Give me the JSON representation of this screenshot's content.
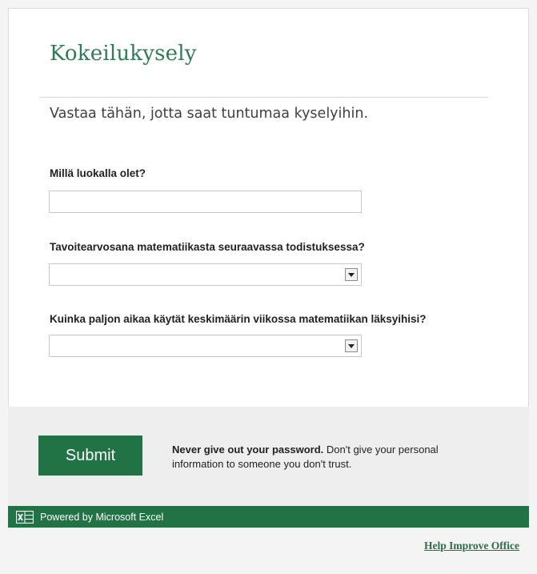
{
  "form": {
    "title": "Kokeilukysely",
    "description": "Vastaa tähän, jotta saat tuntumaa kyselyihin.",
    "questions": [
      {
        "label": "Millä luokalla olet?",
        "type": "text",
        "value": ""
      },
      {
        "label": "Tavoitearvosana matematiikasta seuraavassa todistuksessa?",
        "type": "select",
        "value": ""
      },
      {
        "label": "Kuinka paljon aikaa käytät keskimäärin viikossa matematiikan läksyihisi?",
        "type": "select",
        "value": ""
      }
    ]
  },
  "footer": {
    "submit_label": "Submit",
    "warning_bold": "Never give out your password.",
    "warning_text": " Don't give your personal information to someone you don't trust.",
    "powered_by": "Powered by Microsoft Excel",
    "help_link": "Help Improve Office"
  },
  "colors": {
    "accent": "#217346",
    "title": "#2e7d57"
  },
  "icons": {
    "excel": "excel-logo-icon",
    "dropdown": "chevron-down-icon"
  }
}
